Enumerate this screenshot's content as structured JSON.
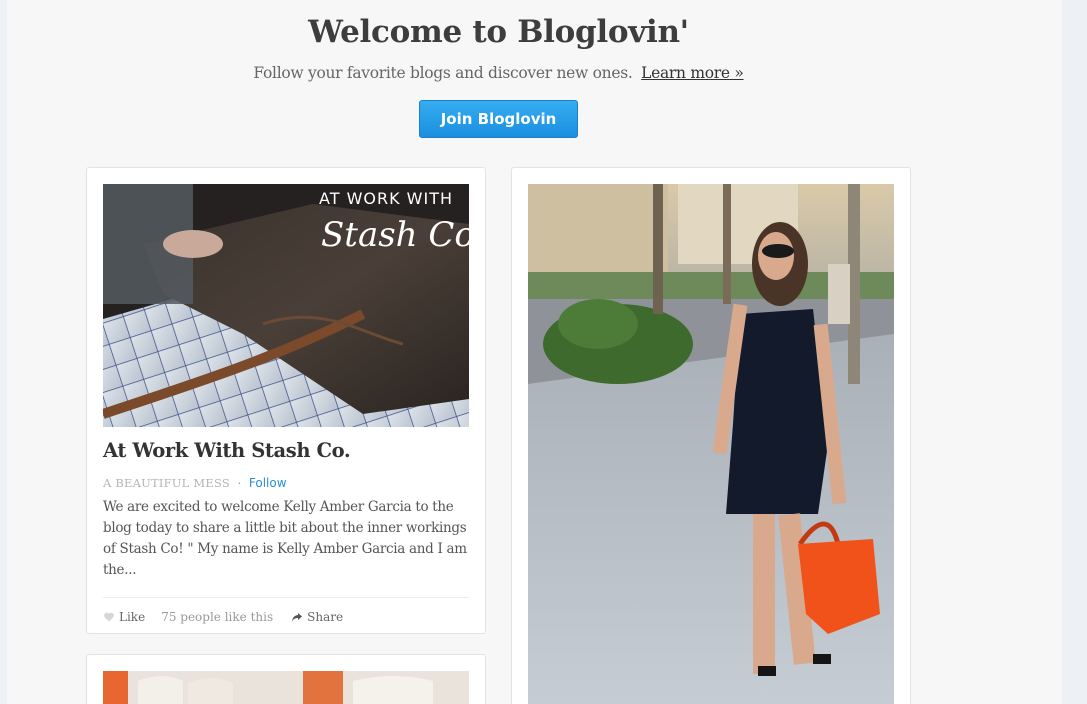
{
  "hero": {
    "title": "Welcome to Bloglovin'",
    "subtitle": "Follow your favorite blogs and discover new ones.",
    "learn_more": "Learn more »",
    "join_button": "Join Bloglovin"
  },
  "posts": [
    {
      "image_overlay_line1": "AT WORK WITH",
      "image_overlay_line2": "Stash Co.",
      "title": "At Work With Stash Co.",
      "blog": "A BEAUTIFUL MESS",
      "follow": "Follow",
      "excerpt": "We are excited to welcome Kelly Amber Garcia to the blog today to share a little bit about the inner workings of Stash Co! \" My name is Kelly Amber Garcia and I am the...",
      "like_label": "Like",
      "likes_count": "75 people like this",
      "share_label": "Share"
    }
  ],
  "colors": {
    "accent": "#2a8ed8",
    "button": "#1a8fe0",
    "page_bg": "#f7f7f7"
  },
  "icons": [
    "heart-icon",
    "share-icon"
  ]
}
